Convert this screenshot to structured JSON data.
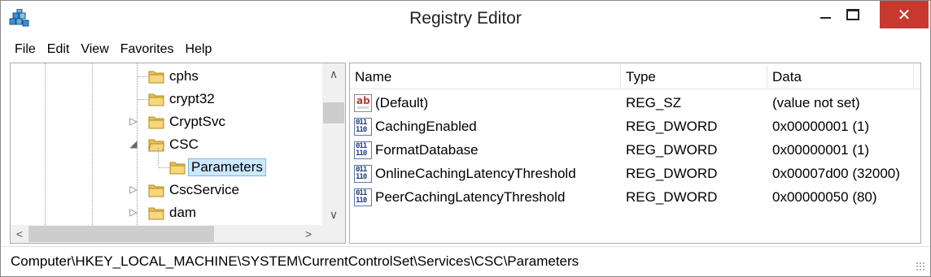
{
  "window": {
    "title": "Registry Editor",
    "accent_close": "#c7392f"
  },
  "menu": [
    "File",
    "Edit",
    "View",
    "Favorites",
    "Help"
  ],
  "tree": {
    "items": [
      {
        "label": "cphs",
        "expander": "",
        "indent": 0,
        "selected": false
      },
      {
        "label": "crypt32",
        "expander": "",
        "indent": 0,
        "selected": false
      },
      {
        "label": "CryptSvc",
        "expander": "▷",
        "indent": 0,
        "selected": false
      },
      {
        "label": "CSC",
        "expander": "◢",
        "indent": 0,
        "selected": false
      },
      {
        "label": "Parameters",
        "expander": "",
        "indent": 1,
        "selected": true
      },
      {
        "label": "CscService",
        "expander": "▷",
        "indent": 0,
        "selected": false
      },
      {
        "label": "dam",
        "expander": "▷",
        "indent": 0,
        "selected": false
      }
    ],
    "scroll_up": "∧",
    "scroll_down": "∨",
    "scroll_left": "<",
    "scroll_right": ">"
  },
  "values": {
    "headers": {
      "name": "Name",
      "type": "Type",
      "data": "Data"
    },
    "rows": [
      {
        "icon": "string-value-icon",
        "name": "(Default)",
        "type": "REG_SZ",
        "data": "(value not set)"
      },
      {
        "icon": "dword-value-icon",
        "name": "CachingEnabled",
        "type": "REG_DWORD",
        "data": "0x00000001 (1)"
      },
      {
        "icon": "dword-value-icon",
        "name": "FormatDatabase",
        "type": "REG_DWORD",
        "data": "0x00000001 (1)"
      },
      {
        "icon": "dword-value-icon",
        "name": "OnlineCachingLatencyThreshold",
        "type": "REG_DWORD",
        "data": "0x00007d00 (32000)"
      },
      {
        "icon": "dword-value-icon",
        "name": "PeerCachingLatencyThreshold",
        "type": "REG_DWORD",
        "data": "0x00000050 (80)"
      }
    ]
  },
  "statusbar": {
    "path": "Computer\\HKEY_LOCAL_MACHINE\\SYSTEM\\CurrentControlSet\\Services\\CSC\\Parameters"
  },
  "icon_glyphs": {
    "string": "ab",
    "dword": "011\n110"
  }
}
